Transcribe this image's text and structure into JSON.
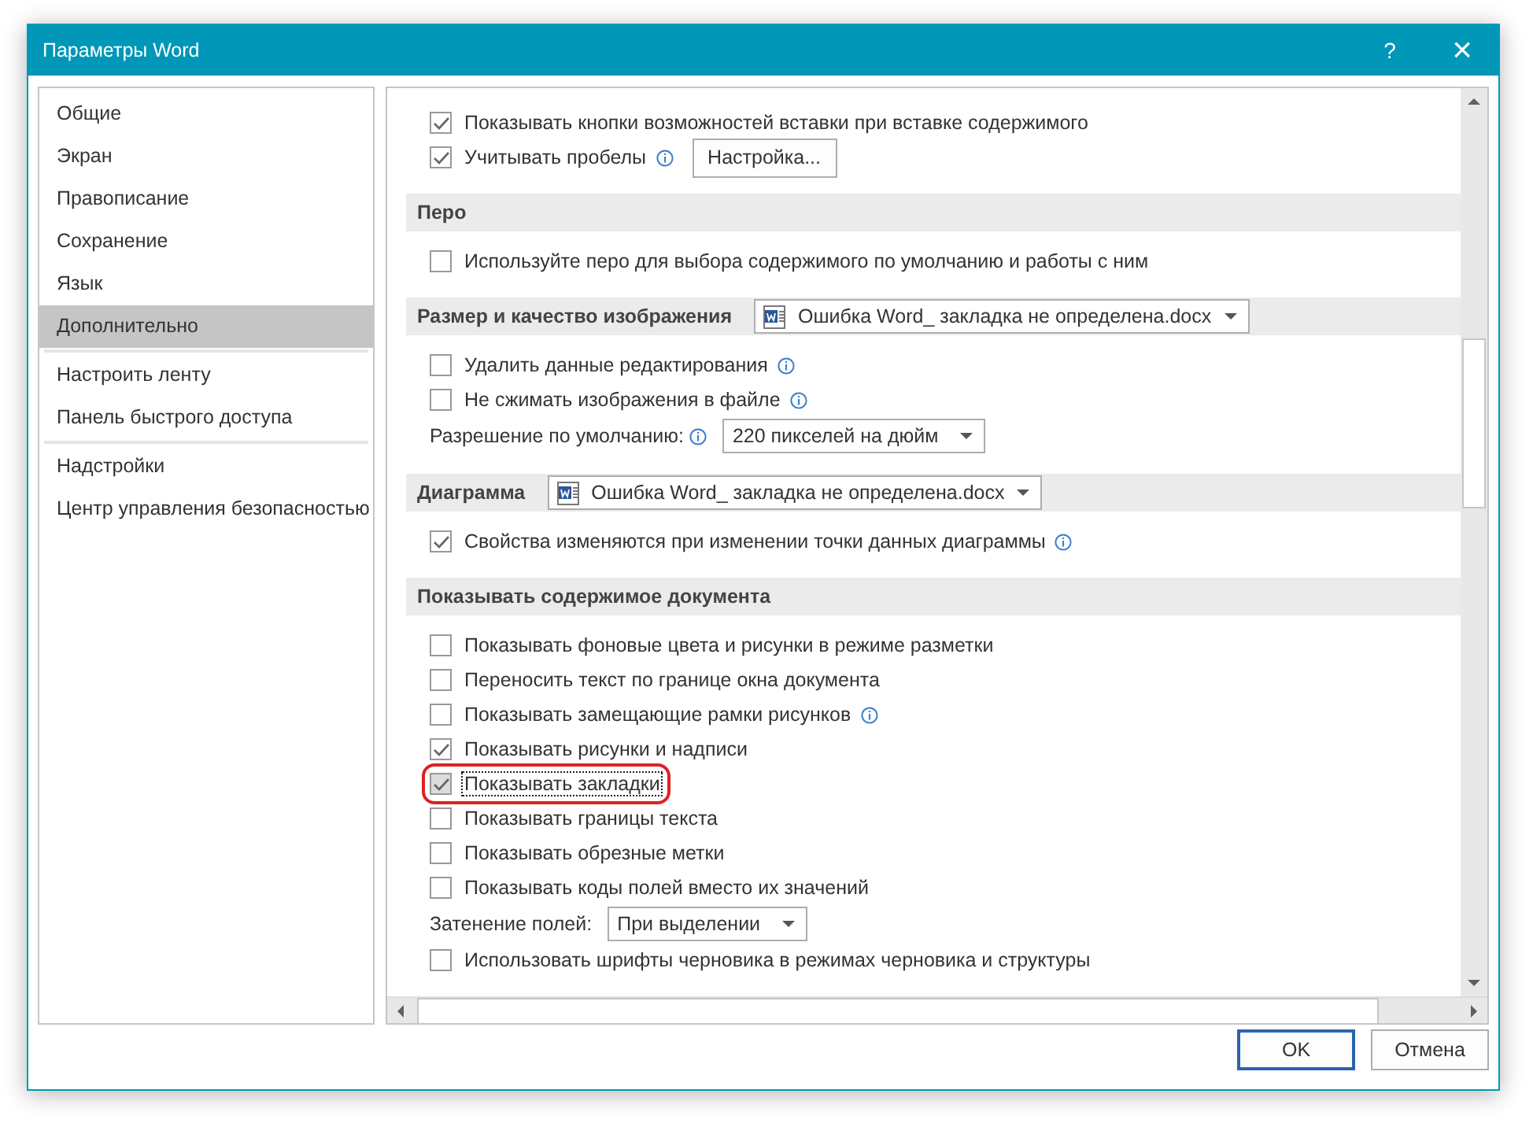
{
  "window": {
    "title": "Параметры Word",
    "help": "?",
    "close": "×"
  },
  "sidebar": {
    "groups": [
      [
        {
          "label": "Общие",
          "selected": false
        },
        {
          "label": "Экран",
          "selected": false
        },
        {
          "label": "Правописание",
          "selected": false
        },
        {
          "label": "Сохранение",
          "selected": false
        },
        {
          "label": "Язык",
          "selected": false
        },
        {
          "label": "Дополнительно",
          "selected": true
        }
      ],
      [
        {
          "label": "Настроить ленту",
          "selected": false
        },
        {
          "label": "Панель быстрого доступа",
          "selected": false
        }
      ],
      [
        {
          "label": "Надстройки",
          "selected": false
        },
        {
          "label": "Центр управления безопасностью",
          "selected": false
        }
      ]
    ]
  },
  "content": {
    "groups": [
      {
        "rows": [
          {
            "kind": "checkbox",
            "label": "Показывать кнопки возможностей вставки при вставке содержимого",
            "checked": true
          },
          {
            "kind": "checkbox",
            "label": "Учитывать пробелы",
            "checked": true,
            "info": true,
            "button": "Настройка..."
          }
        ]
      },
      {
        "header": "Перо",
        "rows": [
          {
            "kind": "checkbox",
            "label": "Используйте перо для выбора содержимого по умолчанию и работы с ним",
            "checked": false
          }
        ]
      },
      {
        "header": "Размер и качество изображения",
        "dropdown": "Ошибка Word_ закладка не определена.docx",
        "rows": [
          {
            "kind": "checkbox",
            "label": "Удалить данные редактирования",
            "checked": false,
            "info": true
          },
          {
            "kind": "checkbox",
            "label": "Не сжимать изображения в файле",
            "checked": false,
            "info": true
          },
          {
            "kind": "select",
            "label": "Разрешение по умолчанию:",
            "info": true,
            "value": "220 пикселей на дюйм"
          }
        ]
      },
      {
        "header": "Диаграмма",
        "dropdown": "Ошибка Word_ закладка не определена.docx",
        "rows": [
          {
            "kind": "checkbox",
            "label": "Свойства изменяются при изменении точки данных диаграммы",
            "checked": true,
            "info": true
          }
        ]
      },
      {
        "header": "Показывать содержимое документа",
        "rows": [
          {
            "kind": "checkbox",
            "label": "Показывать фоновые цвета и рисунки в режиме разметки",
            "checked": false
          },
          {
            "kind": "checkbox",
            "label": "Переносить текст по границе окна документа",
            "checked": false
          },
          {
            "kind": "checkbox",
            "label": "Показывать замещающие рамки рисунков",
            "checked": false,
            "info": true
          },
          {
            "kind": "checkbox",
            "label": "Показывать рисунки и надписи",
            "checked": true
          },
          {
            "kind": "checkbox",
            "label": "Показывать закладки",
            "checked": true,
            "focused": true,
            "highlighted": true
          },
          {
            "kind": "checkbox",
            "label": "Показывать границы текста",
            "checked": false
          },
          {
            "kind": "checkbox",
            "label": "Показывать обрезные метки",
            "checked": false
          },
          {
            "kind": "checkbox",
            "label": "Показывать коды полей вместо их значений",
            "checked": false
          },
          {
            "kind": "select",
            "label": "Затенение полей:",
            "value": "При выделении"
          },
          {
            "kind": "checkbox",
            "label": "Использовать шрифты черновика в режимах черновика и структуры",
            "checked": false
          }
        ]
      }
    ]
  },
  "buttons": [
    {
      "label": "OK",
      "default": true
    },
    {
      "label": "Отмена",
      "default": false
    }
  ]
}
